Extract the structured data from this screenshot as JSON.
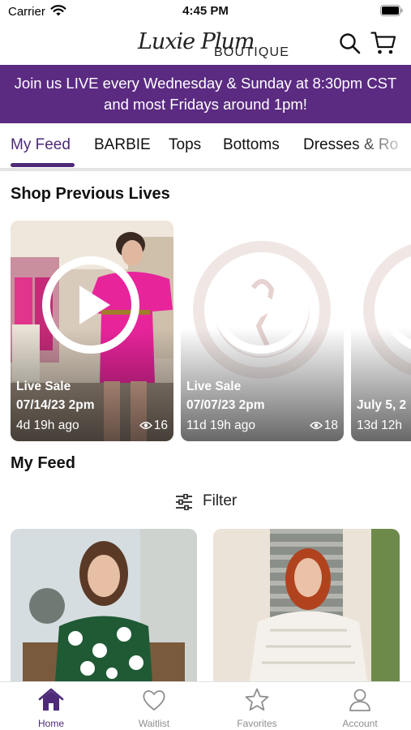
{
  "status_bar": {
    "carrier": "Carrier",
    "time": "4:45 PM"
  },
  "header": {
    "logo_script": "Luxie Plum",
    "logo_word": "BOUTIQUE",
    "search_icon": "search-icon",
    "cart_icon": "cart-icon"
  },
  "banner": {
    "line1": "Join us LIVE every Wednesday & Sunday at 8:30pm CST",
    "line2": "and most Fridays around 1pm!"
  },
  "tabs": [
    "My Feed",
    "BARBIE",
    "Tops",
    "Bottoms",
    "Dresses & Ro"
  ],
  "active_tab": "My Feed",
  "previous_lives": {
    "title": "Shop Previous Lives",
    "cards": [
      {
        "label": "Live Sale",
        "date": "07/14/23 2pm",
        "ago": "4d 19h ago",
        "views": "16"
      },
      {
        "label": "Live Sale",
        "date": "07/07/23 2pm",
        "ago": "11d 19h ago",
        "views": "18"
      },
      {
        "label": "",
        "date": "July 5, 2",
        "ago": "13d 12h",
        "views": ""
      }
    ]
  },
  "feed": {
    "title": "My Feed",
    "filter_label": "Filter"
  },
  "bottom_nav": [
    {
      "label": "Home",
      "icon": "home-icon",
      "active": true
    },
    {
      "label": "Waitlist",
      "icon": "heart-icon",
      "active": false
    },
    {
      "label": "Favorites",
      "icon": "star-icon",
      "active": false
    },
    {
      "label": "Account",
      "icon": "person-icon",
      "active": false
    }
  ],
  "colors": {
    "brand_purple": "#5b2b82",
    "active_purple": "#4e2a78",
    "inactive_gray": "#8e8e8e"
  }
}
